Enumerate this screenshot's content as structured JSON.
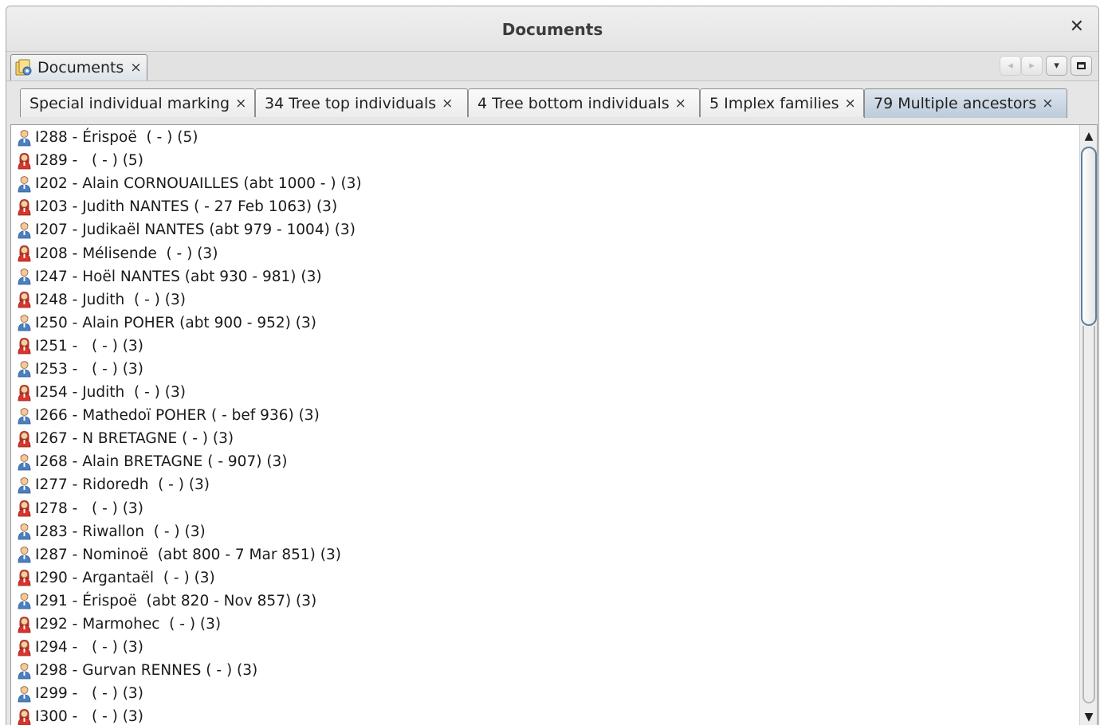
{
  "window": {
    "title": "Documents",
    "close_glyph": "✕"
  },
  "doc_tab": {
    "label": "Documents",
    "icon": "documents-icon",
    "close_glyph": "×"
  },
  "nav": {
    "prev_glyph": "◂",
    "next_glyph": "▸",
    "menu_glyph": "▾",
    "maximize_icon": "maximize-icon"
  },
  "sub_tabs": [
    {
      "label": "Special individual marking",
      "close_glyph": "×",
      "active": false
    },
    {
      "label": "34 Tree top individuals",
      "close_glyph": "×",
      "active": false
    },
    {
      "label": "4 Tree bottom individuals",
      "close_glyph": "×",
      "active": false
    },
    {
      "label": "5 Implex families",
      "close_glyph": "×",
      "active": false
    },
    {
      "label": "79 Multiple ancestors",
      "close_glyph": "×",
      "active": true
    }
  ],
  "list": {
    "items": [
      {
        "sex": "male",
        "text": "I288 - Érispoë  ( - ) (5)"
      },
      {
        "sex": "female",
        "text": "I289 -   ( - ) (5)"
      },
      {
        "sex": "male",
        "text": "I202 - Alain CORNOUAILLES (abt 1000 - ) (3)"
      },
      {
        "sex": "female",
        "text": "I203 - Judith NANTES ( - 27 Feb 1063) (3)"
      },
      {
        "sex": "male",
        "text": "I207 - Judikaël NANTES (abt 979 - 1004) (3)"
      },
      {
        "sex": "female",
        "text": "I208 - Mélisende  ( - ) (3)"
      },
      {
        "sex": "male",
        "text": "I247 - Hoël NANTES (abt 930 - 981) (3)"
      },
      {
        "sex": "female",
        "text": "I248 - Judith  ( - ) (3)"
      },
      {
        "sex": "male",
        "text": "I250 - Alain POHER (abt 900 - 952) (3)"
      },
      {
        "sex": "female",
        "text": "I251 -   ( - ) (3)"
      },
      {
        "sex": "male",
        "text": "I253 -   ( - ) (3)"
      },
      {
        "sex": "female",
        "text": "I254 - Judith  ( - ) (3)"
      },
      {
        "sex": "male",
        "text": "I266 - Mathedoï POHER ( - bef 936) (3)"
      },
      {
        "sex": "female",
        "text": "I267 - N BRETAGNE ( - ) (3)"
      },
      {
        "sex": "male",
        "text": "I268 - Alain BRETAGNE ( - 907) (3)"
      },
      {
        "sex": "male",
        "text": "I277 - Ridoredh  ( - ) (3)"
      },
      {
        "sex": "female",
        "text": "I278 -   ( - ) (3)"
      },
      {
        "sex": "male",
        "text": "I283 - Riwallon  ( - ) (3)"
      },
      {
        "sex": "male",
        "text": "I287 - Nominoë  (abt 800 - 7 Mar 851) (3)"
      },
      {
        "sex": "female",
        "text": "I290 - Argantaël  ( - ) (3)"
      },
      {
        "sex": "male",
        "text": "I291 - Érispoë  (abt 820 - Nov 857) (3)"
      },
      {
        "sex": "female",
        "text": "I292 - Marmohec  ( - ) (3)"
      },
      {
        "sex": "female",
        "text": "I294 -   ( - ) (3)"
      },
      {
        "sex": "male",
        "text": "I298 - Gurvan RENNES ( - ) (3)"
      },
      {
        "sex": "male",
        "text": "I299 -   ( - ) (3)"
      },
      {
        "sex": "female",
        "text": "I300 -   ( - ) (3)"
      }
    ]
  },
  "scrollbar": {
    "up_glyph": "▲",
    "down_glyph": "▼",
    "position_fraction": 0.0
  },
  "colors": {
    "male": "#4a7fc1",
    "female": "#d9342b",
    "active_tab": "#c9d6e3",
    "scroll_thumb_border": "#5f7f9f"
  }
}
